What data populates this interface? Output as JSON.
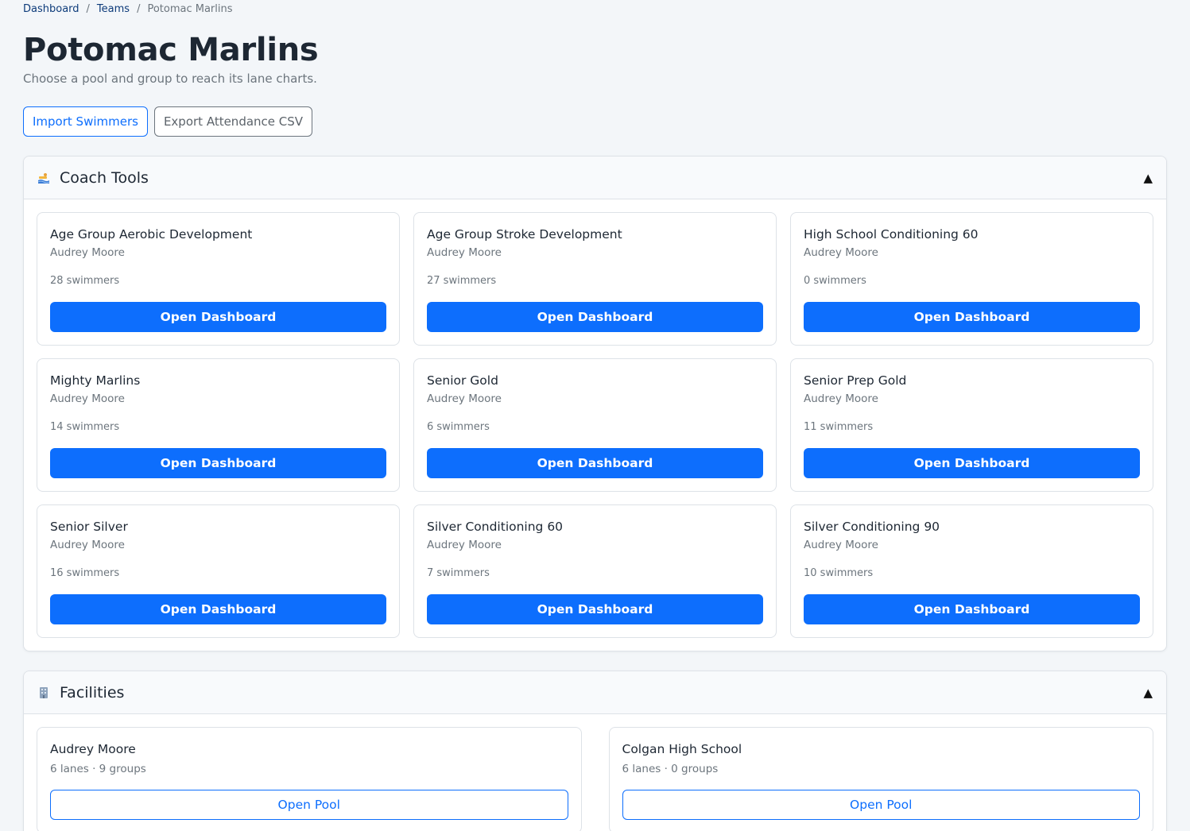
{
  "breadcrumb": {
    "items": [
      "Dashboard",
      "Teams"
    ],
    "separator": "/",
    "current": "Potomac Marlins"
  },
  "header": {
    "title": "Potomac Marlins",
    "subtitle": "Choose a pool and group to reach its lane charts."
  },
  "actions": {
    "import_label": "Import Swimmers",
    "export_label": "Export Attendance CSV"
  },
  "coach_tools": {
    "title": "Coach Tools",
    "icon": "swimmer-icon",
    "toggle": "▲",
    "groups": [
      {
        "name": "Age Group Aerobic Development",
        "pool": "Audrey Moore",
        "count": "28 swimmers",
        "button": "Open Dashboard"
      },
      {
        "name": "Age Group Stroke Development",
        "pool": "Audrey Moore",
        "count": "27 swimmers",
        "button": "Open Dashboard"
      },
      {
        "name": "High School Conditioning 60",
        "pool": "Audrey Moore",
        "count": "0 swimmers",
        "button": "Open Dashboard"
      },
      {
        "name": "Mighty Marlins",
        "pool": "Audrey Moore",
        "count": "14 swimmers",
        "button": "Open Dashboard"
      },
      {
        "name": "Senior Gold",
        "pool": "Audrey Moore",
        "count": "6 swimmers",
        "button": "Open Dashboard"
      },
      {
        "name": "Senior Prep Gold",
        "pool": "Audrey Moore",
        "count": "11 swimmers",
        "button": "Open Dashboard"
      },
      {
        "name": "Senior Silver",
        "pool": "Audrey Moore",
        "count": "16 swimmers",
        "button": "Open Dashboard"
      },
      {
        "name": "Silver Conditioning 60",
        "pool": "Audrey Moore",
        "count": "7 swimmers",
        "button": "Open Dashboard"
      },
      {
        "name": "Silver Conditioning 90",
        "pool": "Audrey Moore",
        "count": "10 swimmers",
        "button": "Open Dashboard"
      }
    ]
  },
  "facilities": {
    "title": "Facilities",
    "icon": "building-icon",
    "toggle": "▲",
    "pools": [
      {
        "name": "Audrey Moore",
        "info": "6 lanes · 9 groups",
        "button": "Open Pool"
      },
      {
        "name": "Colgan High School",
        "info": "6 lanes · 0 groups",
        "button": "Open Pool"
      }
    ]
  },
  "colors": {
    "primary": "#0d6efd",
    "background": "#f3f6f9",
    "muted": "#6c757d"
  }
}
